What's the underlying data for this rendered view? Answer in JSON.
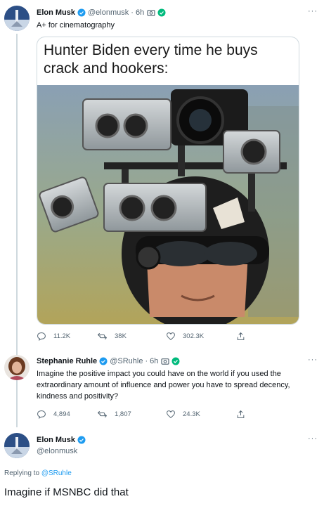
{
  "tweet1": {
    "name": "Elon Musk",
    "handle": "@elonmusk",
    "time": "· 6h",
    "text": "A+ for cinematography",
    "meme_caption": "Hunter Biden every time he buys crack and hookers:",
    "stats": {
      "replies": "11.2K",
      "retweets": "38K",
      "likes": "302.3K"
    }
  },
  "tweet2": {
    "name": "Stephanie Ruhle",
    "handle": "@SRuhle",
    "time": "· 6h",
    "text": "Imagine the positive impact you could have on the world if you used the extraordinary amount of influence and power you have to spread decency, kindness and positivity?",
    "stats": {
      "replies": "4,894",
      "retweets": "1,807",
      "likes": "24.3K"
    }
  },
  "tweet3": {
    "name": "Elon Musk",
    "handle": "@elonmusk",
    "replying_prefix": "Replying to",
    "replying_to": "@SRuhle",
    "text": "Imagine if MSNBC did that"
  },
  "more_label": "···",
  "colors": {
    "verified": "#1d9bf0",
    "camera_badge": "#00ba7c",
    "thread_line": "#cfd9de",
    "muted": "#536471"
  }
}
